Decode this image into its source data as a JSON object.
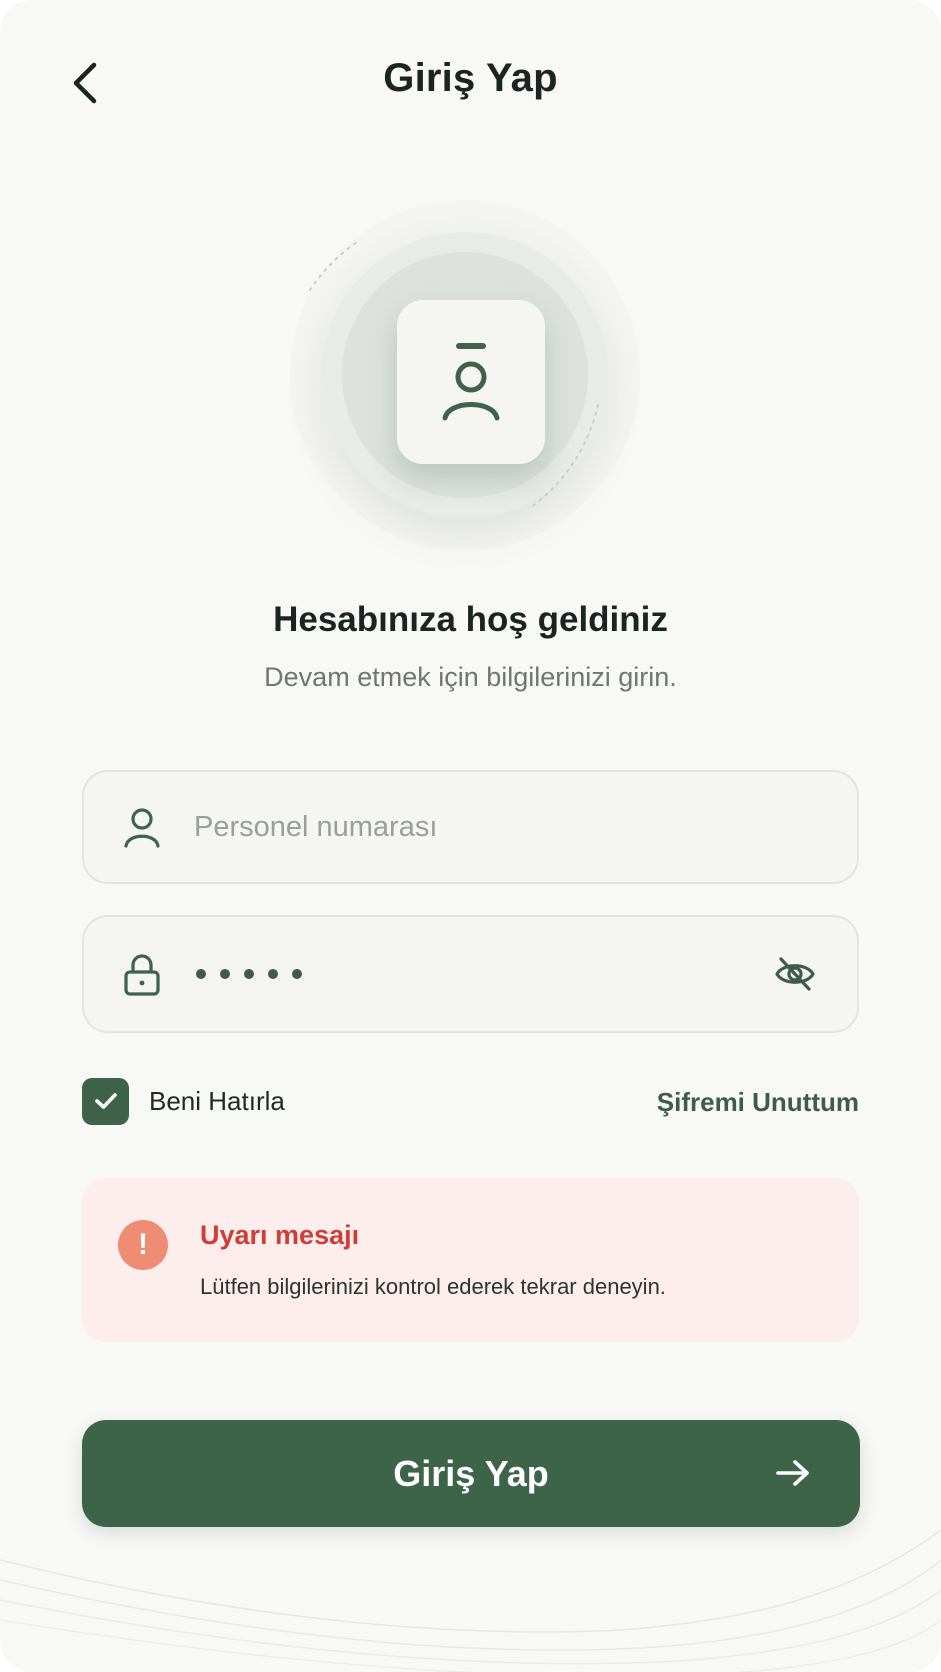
{
  "header": {
    "title": "Giriş Yap",
    "back_icon": "chevron-left-icon"
  },
  "hero": {
    "icon": "employee-badge-icon"
  },
  "welcome": {
    "title": "Hesabınıza hoş geldiniz",
    "subtitle": "Devam etmek için bilgilerinizi girin."
  },
  "form": {
    "username": {
      "placeholder": "Personel numarası",
      "value": "",
      "icon": "user-icon"
    },
    "password": {
      "value": "•••••",
      "icon": "lock-icon",
      "toggle_icon": "eye-off-icon"
    },
    "remember_me": {
      "label": "Beni Hatırla",
      "checked": true
    },
    "forgot_password": "Şifremi Unuttum"
  },
  "alert": {
    "title": "Uyarı mesajı",
    "message": "Lütfen bilgilerinizi kontrol ederek tekrar deneyin.",
    "icon": "exclamation-icon",
    "icon_glyph": "!"
  },
  "submit": {
    "label": "Giriş Yap",
    "icon": "arrow-right-icon"
  },
  "colors": {
    "primary": "#3d6449",
    "alert_bg": "#fdeeed",
    "alert_title": "#cf3e34",
    "alert_icon": "#ef8c74",
    "background": "#f8f8f7"
  }
}
